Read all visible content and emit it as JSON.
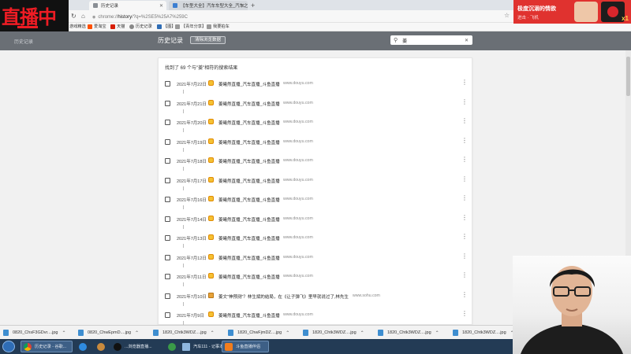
{
  "browser": {
    "tabs": [
      {
        "label": "历史记录",
        "active": true
      },
      {
        "label": "【车型大全】汽车车型大全_汽车之",
        "active": false
      }
    ],
    "url": {
      "prefix": "chrome://",
      "path": "history",
      "query": "/?q=%2SE5%25A7%259C"
    },
    "bookmarks": [
      {
        "label": "游戏精选"
      },
      {
        "label": "爱淘宝"
      },
      {
        "label": "天猫"
      },
      {
        "label": "历史记录"
      },
      {
        "label": "【图】"
      },
      {
        "label": "【青年分享】"
      },
      {
        "label": "我要拍车"
      }
    ]
  },
  "page": {
    "brand": "历史记录",
    "title": "历史记录",
    "clear_button": "清除浏览数据",
    "search_value": "姜",
    "summary": "找到了 69 个与\"姜\"相符的搜索结果"
  },
  "history": [
    {
      "date": "2021年7月22日",
      "title": "姜曦然直播_汽车直播_斗鱼直播",
      "domain": "www.douyu.com",
      "icon": "douyu-icon"
    },
    {
      "date": "2021年7月21日",
      "title": "姜曦然直播_汽车直播_斗鱼直播",
      "domain": "www.douyu.com",
      "icon": "douyu-icon"
    },
    {
      "date": "2021年7月20日",
      "title": "姜曦然直播_汽车直播_斗鱼直播",
      "domain": "www.douyu.com",
      "icon": "douyu-icon"
    },
    {
      "date": "2021年7月19日",
      "title": "姜曦然直播_汽车直播_斗鱼直播",
      "domain": "www.douyu.com",
      "icon": "douyu-icon"
    },
    {
      "date": "2021年7月18日",
      "title": "姜曦然直播_汽车直播_斗鱼直播",
      "domain": "www.douyu.com",
      "icon": "douyu-icon"
    },
    {
      "date": "2021年7月17日",
      "title": "姜曦然直播_汽车直播_斗鱼直播",
      "domain": "www.douyu.com",
      "icon": "douyu-icon"
    },
    {
      "date": "2021年7月16日",
      "title": "姜曦然直播_汽车直播_斗鱼直播",
      "domain": "www.douyu.com",
      "icon": "douyu-icon"
    },
    {
      "date": "2021年7月14日",
      "title": "姜曦然直播_汽车直播_斗鱼直播",
      "domain": "www.douyu.com",
      "icon": "douyu-icon"
    },
    {
      "date": "2021年7月13日",
      "title": "姜曦然直播_汽车直播_斗鱼直播",
      "domain": "www.douyu.com",
      "icon": "douyu-icon"
    },
    {
      "date": "2021年7月12日",
      "title": "姜曦然直播_汽车直播_斗鱼直播",
      "domain": "www.douyu.com",
      "icon": "douyu-icon"
    },
    {
      "date": "2021年7月11日",
      "title": "姜曦然直播_汽车直播_斗鱼直播",
      "domain": "www.douyu.com",
      "icon": "douyu-icon"
    },
    {
      "date": "2021年7月10日",
      "title": "姜文\"神预测\"？林生斌的结局，在《让子弹飞》里早就说过了,林先生",
      "domain": "www.sohu.com",
      "icon": "sohu-icon"
    },
    {
      "date": "2021年7月9日",
      "title": "姜曦然直播_汽车直播_斗鱼直播",
      "domain": "www.douyu.com",
      "icon": "douyu-icon"
    }
  ],
  "downloads": [
    {
      "name": "0820_ChsF3GDvr....jpg"
    },
    {
      "name": "0820_ChwEpmD....jpg"
    },
    {
      "name": "1820_Chtk3WDZ....jpg"
    },
    {
      "name": "1820_ChwFjmDZ....jpg"
    },
    {
      "name": "1820_Chtk3WDZ....jpg"
    },
    {
      "name": "1820_Chtk3WDZ....jpg"
    },
    {
      "name": "1820_Chtk3WDZ....jpg"
    }
  ],
  "taskbar": [
    {
      "label": "历史记录 - 谷歌..."
    },
    {
      "label": "...浏览器直播..."
    },
    {
      "label": "汽车111 - 记事本"
    },
    {
      "label": "斗鱼直播伴侣"
    }
  ],
  "overlays": {
    "logo": "直播中",
    "promo_title": "极度沉溺的情欲",
    "promo_sub": "进击 · 飞机",
    "promo_num": "x1"
  },
  "colors": {
    "accent_red": "#e0322f",
    "header_gray": "#6a6f75",
    "taskbar": "#233b55"
  }
}
